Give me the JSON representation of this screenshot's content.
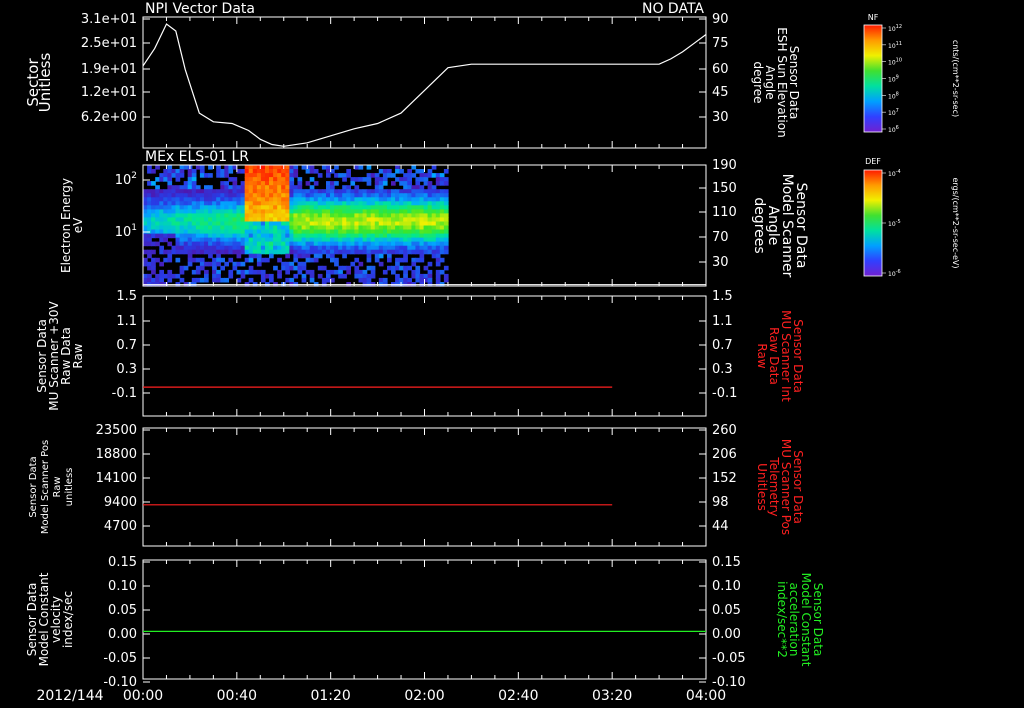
{
  "chart_data": {
    "type": "multi-panel-timeseries",
    "date_label": "2012/144",
    "x_ticks": [
      "00:00",
      "00:40",
      "01:20",
      "02:00",
      "02:40",
      "03:20",
      "04:00"
    ],
    "x_range_minutes": [
      0,
      240
    ],
    "panels": [
      {
        "id": "p1",
        "type": "line",
        "title": "NPI Vector Data",
        "status": "NO DATA",
        "left_label": [
          "Sector",
          "Unitless"
        ],
        "left_label_color": "#ffffff",
        "left_ticks": [
          "3.1e+01",
          "2.5e+01",
          "1.9e+01",
          "1.2e+01",
          "6.2e+00"
        ],
        "right_label": [
          "Sensor Data",
          "ESH Sun Elevation",
          "Angle",
          "degree"
        ],
        "right_label_color": "#ffffff",
        "right_ticks": [
          "90",
          "75",
          "60",
          "45",
          "30"
        ],
        "ylim": [
          15,
          90
        ],
        "series": [
          {
            "color": "#ffffff",
            "x": [
              0,
              5,
              10,
              14,
              18,
              24,
              30,
              38,
              45,
              50,
              55,
              60,
              70,
              80,
              90,
              100,
              110,
              120,
              130,
              140,
              150,
              160,
              170,
              180,
              190,
              200,
              210,
              220,
              225,
              230,
              235,
              240
            ],
            "y": [
              62,
              72,
              86,
              82,
              60,
              35,
              30,
              29,
              25,
              20,
              17,
              16,
              18,
              22,
              26,
              29,
              35,
              48,
              61,
              63,
              63,
              63,
              63,
              63,
              63,
              63,
              63,
              63,
              66,
              70,
              75,
              80
            ]
          }
        ]
      },
      {
        "id": "p2",
        "type": "heatmap",
        "title": "MEx ELS-01 LR",
        "left_label": [
          "Electron Energy",
          "eV"
        ],
        "left_label_color": "#ffffff",
        "left_ticks": [
          "10^2",
          "10^1"
        ],
        "right_label": [
          "Sensor Data",
          "Model Scanner",
          "Angle",
          "degrees"
        ],
        "right_label_color": "#ffffff",
        "right_ticks": [
          "190",
          "150",
          "110",
          "70",
          "30"
        ],
        "ylim_log_eV": [
          1,
          200
        ],
        "right_ylim": [
          10,
          190
        ],
        "data_x_range_minutes": [
          0,
          130
        ],
        "white_line_value_deg": 12
      },
      {
        "id": "p3",
        "type": "line",
        "left_label": [
          "Sensor Data",
          "MU Scanner +30V",
          "Raw Data",
          "Raw"
        ],
        "left_label_color": "#ffffff",
        "left_ticks": [
          "1.5",
          "1.1",
          "0.7",
          "0.3",
          "-0.1"
        ],
        "right_label": [
          "Sensor Data",
          "MU Scanner Int",
          "Raw Data",
          "Raw"
        ],
        "right_label_color": "#ff2020",
        "right_ticks": [
          "1.5",
          "1.1",
          "0.7",
          "0.3",
          "-0.1"
        ],
        "ylim": [
          -0.45,
          1.5
        ],
        "series": [
          {
            "color": "#ff2020",
            "x": [
              0,
              200
            ],
            "y": [
              0.02,
              0.02
            ]
          }
        ]
      },
      {
        "id": "p4",
        "type": "line",
        "left_label": [
          "Sensor Data",
          "Model Scanner Pos",
          "Raw",
          "unitless"
        ],
        "left_label_color": "#ffffff",
        "left_ticks": [
          "23500",
          "18800",
          "14100",
          "9400",
          "4700"
        ],
        "right_label": [
          "Sensor Data",
          "MU Scanner Pos",
          "Telemetry",
          "Unitless"
        ],
        "right_label_color": "#ff2020",
        "right_ticks": [
          "260",
          "206",
          "152",
          "98",
          "44"
        ],
        "ylim": [
          0,
          23500
        ],
        "series": [
          {
            "color": "#ff2020",
            "x": [
              0,
              200
            ],
            "y": [
              8200,
              8200
            ]
          }
        ]
      },
      {
        "id": "p5",
        "type": "line",
        "left_label": [
          "Sensor Data",
          "Model Constant",
          "velocity",
          "index/sec"
        ],
        "left_label_color": "#ffffff",
        "left_ticks": [
          "0.15",
          "0.10",
          "0.05",
          "0.00",
          "-0.05",
          "-0.10"
        ],
        "right_label": [
          "Sensor Data",
          "Model Constant",
          "acceleration",
          "index/sec**2"
        ],
        "right_label_color": "#22ee22",
        "right_ticks": [
          "0.15",
          "0.10",
          "0.05",
          "0.00",
          "-0.05",
          "-0.10"
        ],
        "ylim": [
          -0.1,
          0.15
        ],
        "series": [
          {
            "color": "#22ee22",
            "x": [
              0,
              240
            ],
            "y": [
              0,
              0
            ]
          }
        ]
      }
    ],
    "colorbars": [
      {
        "id": "cb1",
        "top_label": "NF",
        "side_label": "cnts/(cm**2-sr-sec)",
        "tick_labels": [
          "10^12",
          "10^11",
          "10^10",
          "10^9",
          "10^8",
          "10^7",
          "10^6"
        ]
      },
      {
        "id": "cb2",
        "top_label": "DEF",
        "side_label": "ergs/(cm**2-sr-sec-eV)",
        "tick_labels": [
          "10^-4",
          "10^-5",
          "10^-6"
        ]
      }
    ]
  }
}
